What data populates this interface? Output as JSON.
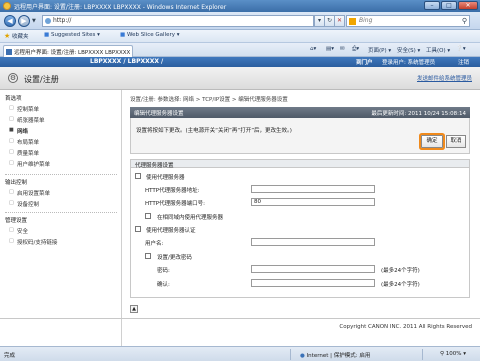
{
  "browser": {
    "title": "远程用户界面: 设置/注册: LBPXXXX LBPXXXX - Windows Internet Explorer",
    "url": "http://",
    "search_placeholder": "Bing",
    "favorites_label": "收藏夹",
    "favorites": [
      "Suggested Sites ▾",
      "Web Slice Gallery ▾"
    ],
    "tab_title": "远程用户界面: 设置/注册: LBPXXXX LBPXXXX",
    "commands": [
      "页面(P) ▾",
      "安全(S) ▾",
      "工具(O) ▾"
    ],
    "status_done": "完成",
    "status_zone": "Internet | 保护模式: 启用",
    "status_zoom": "100%",
    "win_controls": [
      "–",
      "□",
      "✕"
    ]
  },
  "header": {
    "device_name": "LBPXXXX / LBPXXXX /",
    "to_portal": "到门户",
    "login_user": "登录用户: 系统管理员",
    "logout": "注销",
    "page_title": "设置/注册",
    "send_to_admin": "发送邮件给系统管理员"
  },
  "sidebar": {
    "preferences_group": "首选项",
    "preferences_items": [
      "控制菜单",
      "纸张器菜单",
      "网络",
      "布局菜单",
      "质量菜单",
      "用户维护菜单"
    ],
    "output_group": "输出控制",
    "output_items": [
      "启用设置菜单",
      "设备控制"
    ],
    "mgmt_group": "管理设置",
    "mgmt_items": [
      "安全",
      "授权码/支持链接"
    ],
    "current_item": "网络"
  },
  "main": {
    "breadcrumb": "设置/注册: 参数选择: 网络 > TCP/IP设置 > 编辑代理服务器设置",
    "card_title": "编辑代理服务器设置",
    "timestamp": "最后更新时间: 2011 10/24 15:08:14",
    "message": "设置将按如下更改。(主电源开关“关闭”再“打开”后，更改生效。)",
    "ok_label": "确定",
    "cancel_label": "取消",
    "section_title": "代理服务器设置",
    "use_proxy": "使用代理服务器",
    "proxy_address_label": "HTTP代理服务器地址:",
    "proxy_address_value": "",
    "proxy_port_label": "HTTP代理服务器端口号:",
    "proxy_port_value": "80",
    "same_domain": "在相同域内使用代理服务器",
    "use_auth": "使用代理服务器认证",
    "username_label": "用户名:",
    "set_password": "设置/更改密码",
    "password_label": "密码:",
    "confirm_label": "确认:",
    "max_note": "(最多24个字符)",
    "copyright": "Copyright CANON INC. 2011 All Rights Reserved"
  }
}
